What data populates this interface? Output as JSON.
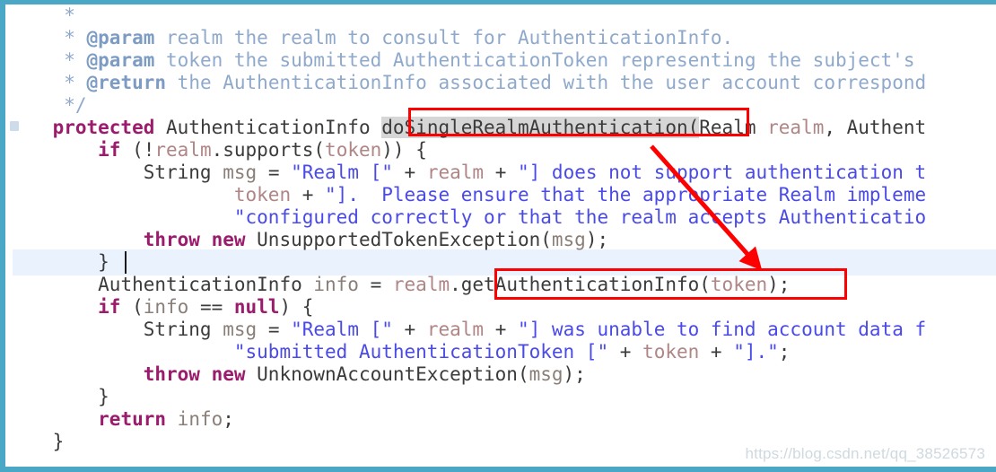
{
  "window": {
    "border_color": "#4aa8c6",
    "background": "#ffffff"
  },
  "editor": {
    "caret_line_index": 7,
    "caret_line_highlight_color": "#e9f2fd",
    "selection_highlight_color": "#d6d6d6",
    "lines": [
      {
        "indent": "     ",
        "segments": [
          {
            "cls": "tok-doc",
            "text": "*"
          }
        ]
      },
      {
        "indent": "     ",
        "segments": [
          {
            "cls": "tok-doc",
            "text": "* "
          },
          {
            "cls": "tok-doctag",
            "text": "@param"
          },
          {
            "cls": "tok-doc",
            "text": " realm the realm to consult for AuthenticationInfo."
          }
        ]
      },
      {
        "indent": "     ",
        "segments": [
          {
            "cls": "tok-doc",
            "text": "* "
          },
          {
            "cls": "tok-doctag",
            "text": "@param"
          },
          {
            "cls": "tok-doc",
            "text": " token the submitted AuthenticationToken representing the subject's"
          }
        ]
      },
      {
        "indent": "     ",
        "segments": [
          {
            "cls": "tok-doc",
            "text": "* "
          },
          {
            "cls": "tok-doctag",
            "text": "@return"
          },
          {
            "cls": "tok-doc",
            "text": " the AuthenticationInfo associated with the user account correspond"
          }
        ]
      },
      {
        "indent": "     ",
        "segments": [
          {
            "cls": "tok-doc",
            "text": "*/"
          }
        ]
      },
      {
        "indent": "    ",
        "segments": [
          {
            "cls": "tok-kw",
            "text": "protected"
          },
          {
            "cls": "tok-plain",
            "text": " AuthenticationInfo "
          },
          {
            "cls": "tok-hl tok-method",
            "text": "doSingleRealmAuthentication("
          },
          {
            "cls": "tok-plain",
            "text": "Realm "
          },
          {
            "cls": "tok-param",
            "text": "realm"
          },
          {
            "cls": "tok-plain",
            "text": ", Authent"
          }
        ]
      },
      {
        "indent": "        ",
        "segments": [
          {
            "cls": "tok-kw",
            "text": "if"
          },
          {
            "cls": "tok-plain",
            "text": " (!"
          },
          {
            "cls": "tok-param",
            "text": "realm"
          },
          {
            "cls": "tok-plain",
            "text": ".supports("
          },
          {
            "cls": "tok-param",
            "text": "token"
          },
          {
            "cls": "tok-plain",
            "text": ")) {"
          }
        ]
      },
      {
        "indent": "            ",
        "segments": [
          {
            "cls": "tok-plain",
            "text": "String "
          },
          {
            "cls": "tok-local",
            "text": "msg"
          },
          {
            "cls": "tok-plain",
            "text": " = "
          },
          {
            "cls": "tok-str",
            "text": "\"Realm [\""
          },
          {
            "cls": "tok-plain",
            "text": " + "
          },
          {
            "cls": "tok-param",
            "text": "realm"
          },
          {
            "cls": "tok-plain",
            "text": " + "
          },
          {
            "cls": "tok-str",
            "text": "\"] does not support authentication t"
          }
        ]
      },
      {
        "indent": "                    ",
        "segments": [
          {
            "cls": "tok-param",
            "text": "token"
          },
          {
            "cls": "tok-plain",
            "text": " + "
          },
          {
            "cls": "tok-str",
            "text": "\"].  Please ensure that the appropriate Realm impleme"
          }
        ]
      },
      {
        "indent": "                    ",
        "segments": [
          {
            "cls": "tok-str",
            "text": "\"configured correctly or that the realm accepts Authenticatio"
          }
        ]
      },
      {
        "indent": "            ",
        "segments": [
          {
            "cls": "tok-kw",
            "text": "throw new"
          },
          {
            "cls": "tok-plain",
            "text": " UnsupportedTokenException("
          },
          {
            "cls": "tok-local",
            "text": "msg"
          },
          {
            "cls": "tok-plain",
            "text": ");"
          }
        ]
      },
      {
        "indent": "        ",
        "segments": [
          {
            "cls": "tok-plain",
            "text": "}"
          }
        ]
      },
      {
        "indent": "        ",
        "segments": [
          {
            "cls": "tok-plain",
            "text": "AuthenticationInfo "
          },
          {
            "cls": "tok-local",
            "text": "info"
          },
          {
            "cls": "tok-plain",
            "text": " = "
          },
          {
            "cls": "tok-param",
            "text": "realm"
          },
          {
            "cls": "tok-plain",
            "text": ".getAuthenticationInfo("
          },
          {
            "cls": "tok-param",
            "text": "token"
          },
          {
            "cls": "tok-plain",
            "text": ");"
          }
        ]
      },
      {
        "indent": "        ",
        "segments": [
          {
            "cls": "tok-kw",
            "text": "if"
          },
          {
            "cls": "tok-plain",
            "text": " ("
          },
          {
            "cls": "tok-local",
            "text": "info"
          },
          {
            "cls": "tok-plain",
            "text": " == "
          },
          {
            "cls": "tok-kw",
            "text": "null"
          },
          {
            "cls": "tok-plain",
            "text": ") {"
          }
        ]
      },
      {
        "indent": "            ",
        "segments": [
          {
            "cls": "tok-plain",
            "text": "String "
          },
          {
            "cls": "tok-local",
            "text": "msg"
          },
          {
            "cls": "tok-plain",
            "text": " = "
          },
          {
            "cls": "tok-str",
            "text": "\"Realm [\""
          },
          {
            "cls": "tok-plain",
            "text": " + "
          },
          {
            "cls": "tok-param",
            "text": "realm"
          },
          {
            "cls": "tok-plain",
            "text": " + "
          },
          {
            "cls": "tok-str",
            "text": "\"] was unable to find account data f"
          }
        ]
      },
      {
        "indent": "                    ",
        "segments": [
          {
            "cls": "tok-str",
            "text": "\"submitted AuthenticationToken [\""
          },
          {
            "cls": "tok-plain",
            "text": " + "
          },
          {
            "cls": "tok-param",
            "text": "token"
          },
          {
            "cls": "tok-plain",
            "text": " + "
          },
          {
            "cls": "tok-str",
            "text": "\"].\""
          },
          {
            "cls": "tok-plain",
            "text": ";"
          }
        ]
      },
      {
        "indent": "            ",
        "segments": [
          {
            "cls": "tok-kw",
            "text": "throw new"
          },
          {
            "cls": "tok-plain",
            "text": " UnknownAccountException("
          },
          {
            "cls": "tok-local",
            "text": "msg"
          },
          {
            "cls": "tok-plain",
            "text": ");"
          }
        ]
      },
      {
        "indent": "        ",
        "segments": [
          {
            "cls": "tok-plain",
            "text": "}"
          }
        ]
      },
      {
        "indent": "        ",
        "segments": [
          {
            "cls": "tok-kw",
            "text": "return"
          },
          {
            "cls": "tok-plain",
            "text": " "
          },
          {
            "cls": "tok-local",
            "text": "info"
          },
          {
            "cls": "tok-plain",
            "text": ";"
          }
        ]
      },
      {
        "indent": "    ",
        "segments": [
          {
            "cls": "tok-plain",
            "text": "}"
          }
        ]
      }
    ]
  },
  "annotations": {
    "color": "#ff0000",
    "box_method_label": "doSingleRealmAuthentication(",
    "box_call_label": "getAuthenticationInfo(token)",
    "arrow_from_box": "box-method",
    "arrow_to_box": "box-call"
  },
  "watermark": {
    "text": "https://blog.csdn.net/qq_38526573",
    "color": "#cfd9de"
  }
}
